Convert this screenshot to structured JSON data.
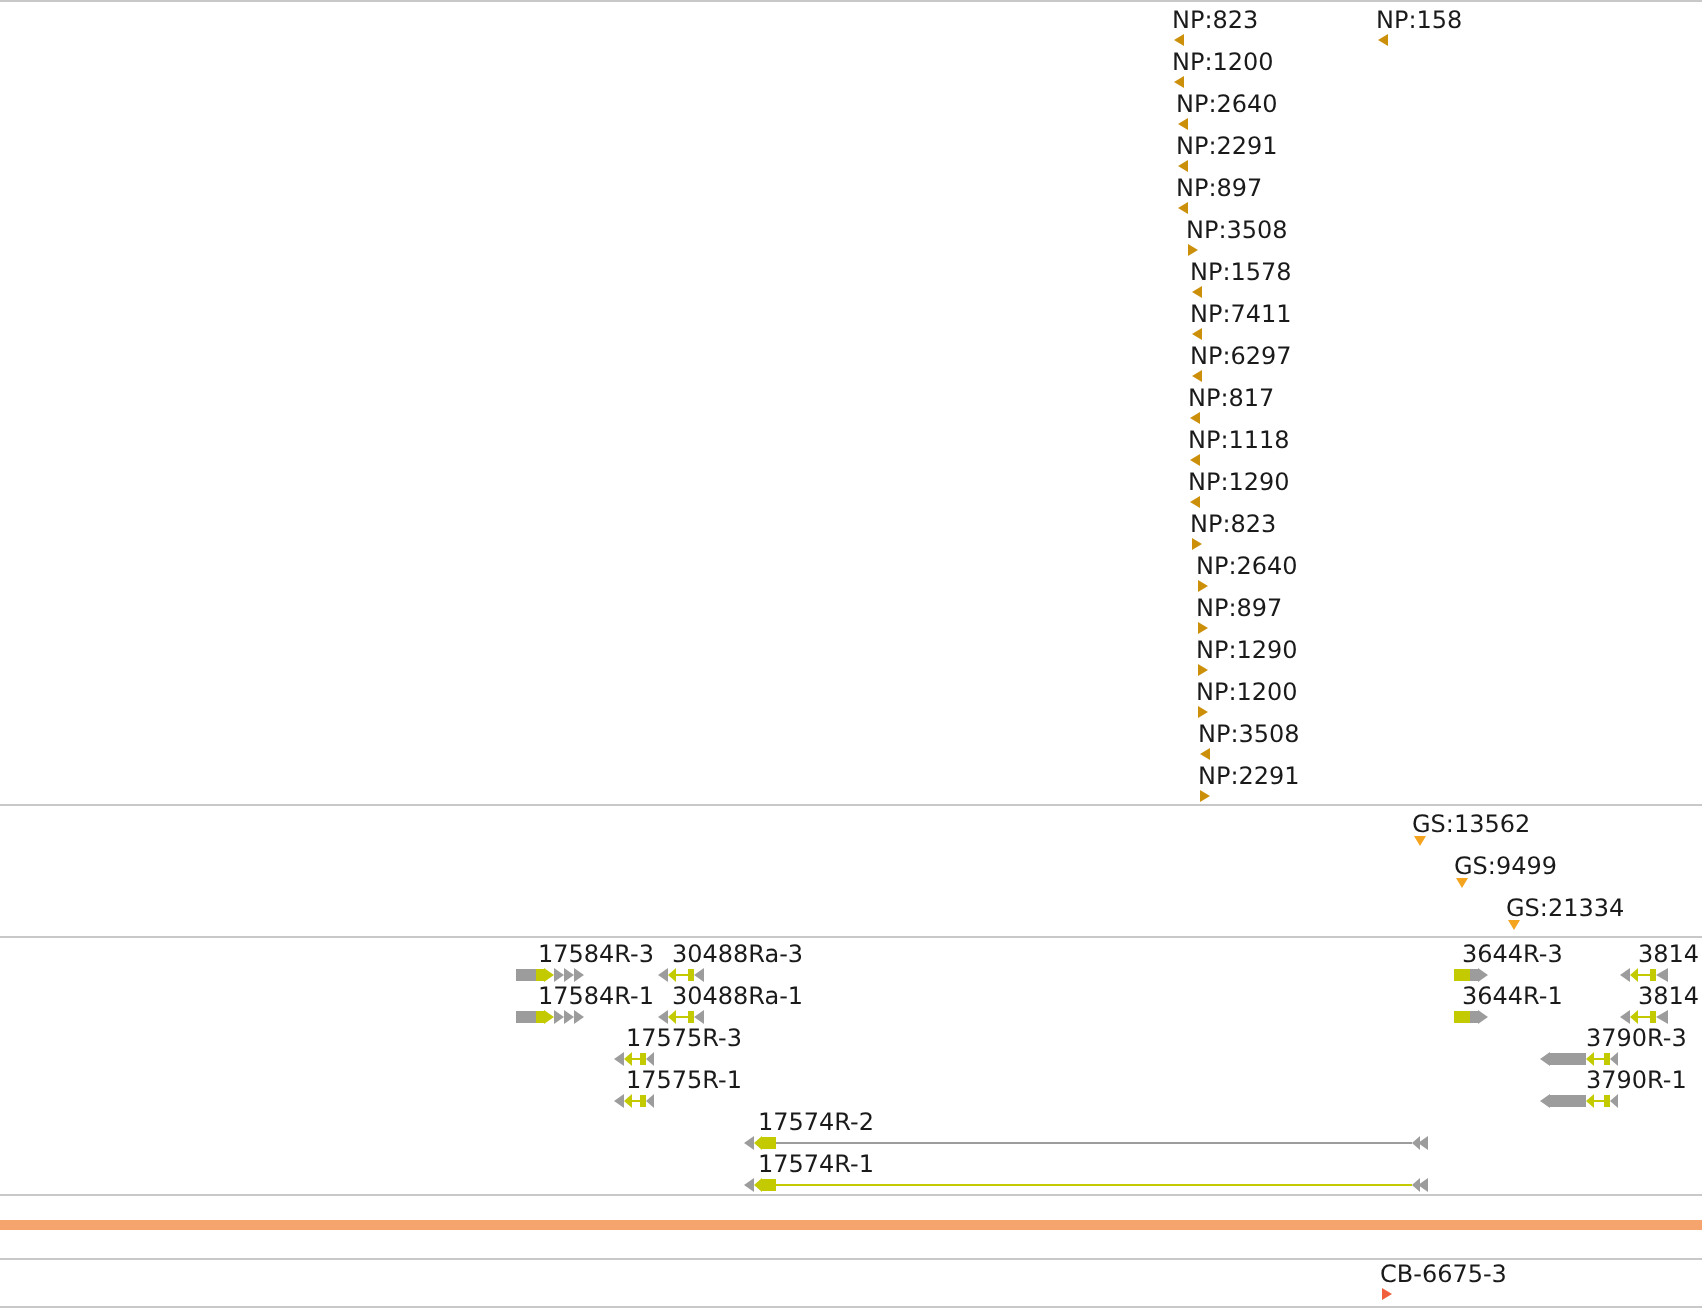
{
  "tracks": [
    {
      "kind": "features",
      "color": "#cc8f0a",
      "features": [
        {
          "label": "NP:823",
          "reverse": true
        },
        {
          "label": "NP:158",
          "reverse": true
        },
        {
          "label": "NP:1200",
          "reverse": true
        },
        {
          "label": "NP:2640",
          "reverse": true
        },
        {
          "label": "NP:2291",
          "reverse": true
        },
        {
          "label": "NP:897",
          "reverse": true
        },
        {
          "label": "NP:3508",
          "reverse": false
        },
        {
          "label": "NP:1578",
          "reverse": true
        },
        {
          "label": "NP:7411",
          "reverse": true
        },
        {
          "label": "NP:6297",
          "reverse": true
        },
        {
          "label": "NP:817",
          "reverse": true
        },
        {
          "label": "NP:1118",
          "reverse": true
        },
        {
          "label": "NP:1290",
          "reverse": true
        },
        {
          "label": "NP:823",
          "reverse": false
        },
        {
          "label": "NP:2640",
          "reverse": false
        },
        {
          "label": "NP:897",
          "reverse": false
        },
        {
          "label": "NP:1290",
          "reverse": false
        },
        {
          "label": "NP:1200",
          "reverse": false
        },
        {
          "label": "NP:3508",
          "reverse": true
        },
        {
          "label": "NP:2291",
          "reverse": false
        }
      ]
    },
    {
      "kind": "sites",
      "color": "#f4a41e",
      "features": [
        {
          "label": "GS:13562"
        },
        {
          "label": "GS:9499"
        },
        {
          "label": "GS:21334"
        }
      ]
    },
    {
      "kind": "genes",
      "features": [
        {
          "label": "17584R-3",
          "reverse": false
        },
        {
          "label": "30488Ra-3",
          "reverse": true
        },
        {
          "label": "3644R-3",
          "reverse": false
        },
        {
          "label": "3814",
          "reverse": true
        },
        {
          "label": "17584R-1",
          "reverse": false
        },
        {
          "label": "30488Ra-1",
          "reverse": true
        },
        {
          "label": "3644R-1",
          "reverse": false
        },
        {
          "label": "3814",
          "reverse": true
        },
        {
          "label": "17575R-3",
          "reverse": true
        },
        {
          "label": "3790R-3",
          "reverse": true
        },
        {
          "label": "17575R-1",
          "reverse": true
        },
        {
          "label": "3790R-1",
          "reverse": true
        },
        {
          "label": "17574R-2",
          "reverse": true
        },
        {
          "label": "17574R-1",
          "reverse": true
        }
      ]
    },
    {
      "kind": "sequence"
    },
    {
      "kind": "features",
      "color": "#f0603c",
      "features": [
        {
          "label": "CB-6675-3",
          "reverse": false
        }
      ]
    }
  ]
}
